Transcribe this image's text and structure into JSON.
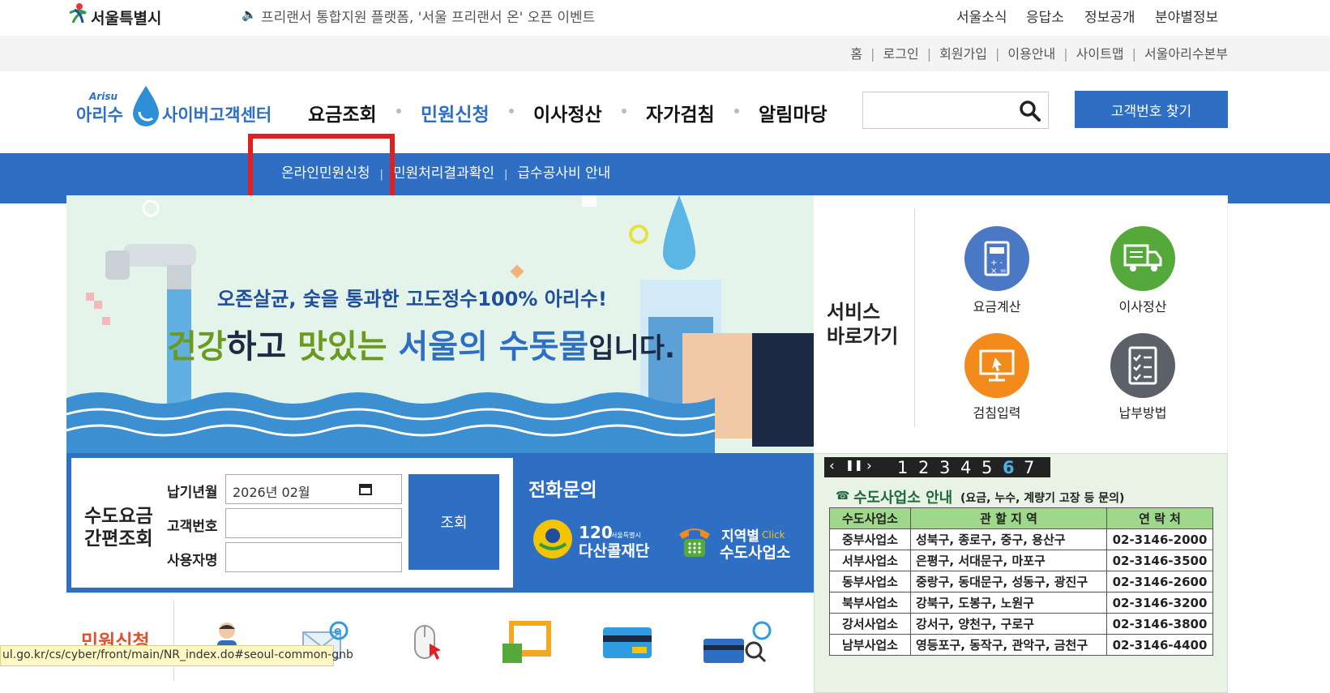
{
  "top": {
    "logo_text": "서울특별시",
    "notice": "프리랜서 통합지원 플랫폼, '서울 프리랜서 온' 오픈 이벤트",
    "menu": [
      "서울소식",
      "응답소",
      "정보공개",
      "분야별정보"
    ]
  },
  "util": {
    "links": [
      "홈",
      "로그인",
      "회원가입",
      "이용안내",
      "사이트맵",
      "서울아리수본부"
    ]
  },
  "header": {
    "logo_small": "Arisu",
    "logo_main": "아리수",
    "logo_center": "사이버고객센터",
    "gnb": [
      "요금조회",
      "민원신청",
      "이사정산",
      "자가검침",
      "알림마당"
    ],
    "search_placeholder": "",
    "find_button": "고객번호 찾기"
  },
  "subnav": {
    "items": [
      "온라인민원신청",
      "민원처리결과확인",
      "급수공사비 안내"
    ]
  },
  "banner": {
    "line1": "오존살균, 숯을 통과한 고도정수100% 아리수!",
    "line2_a": "건강",
    "line2_b": "하고 ",
    "line2_c": "맛있는",
    "line2_d": " 서울의 수돗물",
    "line2_e": "입니다."
  },
  "services": {
    "title_line1": "서비스",
    "title_line2": "바로가기",
    "items": [
      {
        "label": "요금계산",
        "icon": "calculator-icon",
        "color": "#4a78c4"
      },
      {
        "label": "이사정산",
        "icon": "truck-icon",
        "color": "#55a83a"
      },
      {
        "label": "검침입력",
        "icon": "monitor-icon",
        "color": "#f28a1c"
      },
      {
        "label": "납부방법",
        "icon": "checklist-icon",
        "color": "#5b6069"
      }
    ]
  },
  "quick": {
    "title_line1": "수도요금",
    "title_line2": "간편조회",
    "labels": [
      "납기년월",
      "고객번호",
      "사용자명"
    ],
    "date_value": "2026년 02월",
    "submit": "조회"
  },
  "phone": {
    "title": "전화문의",
    "dasan_num": "120",
    "dasan_small": "서울특별시",
    "dasan_name": "다산콜재단",
    "region_top": "지역별",
    "region_click": "Click",
    "region_name": "수도사업소"
  },
  "offices": {
    "pager": [
      "1",
      "2",
      "3",
      "4",
      "5",
      "6",
      "7"
    ],
    "active_page": "6",
    "title": "수도사업소 안내",
    "subtitle": "(요금, 누수, 계량기 고장 등 문의)",
    "headers": [
      "수도사업소",
      "관 할 지 역",
      "연 락 처"
    ],
    "rows": [
      [
        "중부사업소",
        "성북구, 종로구, 중구, 용산구",
        "02-3146-2000"
      ],
      [
        "서부사업소",
        "은평구, 서대문구, 마포구",
        "02-3146-3500"
      ],
      [
        "동부사업소",
        "중랑구, 동대문구, 성동구, 광진구",
        "02-3146-2600"
      ],
      [
        "북부사업소",
        "강북구, 도봉구, 노원구",
        "02-3146-3200"
      ],
      [
        "강서사업소",
        "강서구, 양천구, 구로구",
        "02-3146-3800"
      ],
      [
        "남부사업소",
        "영등포구, 동작구, 관악구, 금천구",
        "02-3146-4400"
      ]
    ]
  },
  "minwon": {
    "title": "민원신청"
  },
  "status_url": "ul.go.kr/cs/cyber/front/main/NR_index.do#seoul-common-gnb",
  "colors": {
    "brand_blue": "#2f6fc3",
    "highlight_red": "#e02020"
  }
}
